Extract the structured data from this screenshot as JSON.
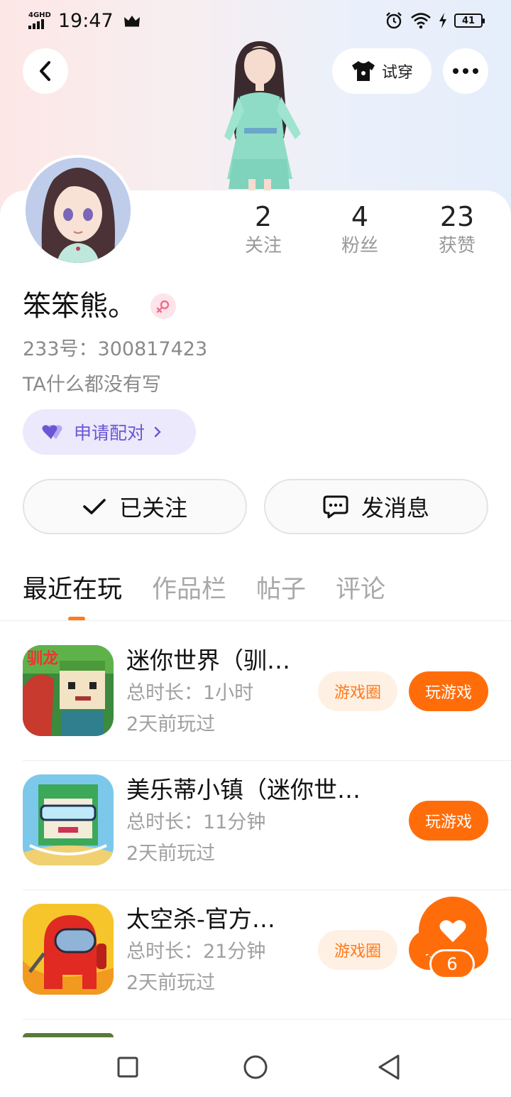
{
  "status_bar": {
    "network": "4GHD",
    "time": "19:47",
    "battery": "41"
  },
  "header": {
    "tryon_label": "试穿"
  },
  "profile": {
    "username": "笨笨熊。",
    "uid_text": "233号：300817423",
    "bio": "TA什么都没有写",
    "pair_label": "申请配对"
  },
  "stats": [
    {
      "value": "2",
      "label": "关注"
    },
    {
      "value": "4",
      "label": "粉丝"
    },
    {
      "value": "23",
      "label": "获赞"
    }
  ],
  "actions": {
    "follow_label": "已关注",
    "message_label": "发消息"
  },
  "tabs": [
    "最近在玩",
    "作品栏",
    "帖子",
    "评论"
  ],
  "games": [
    {
      "title": "迷你世界（驯…",
      "duration": "总时长：1小时",
      "last_played": "2天前玩过",
      "circle_label": "游戏圈",
      "play_label": "玩游戏"
    },
    {
      "title": "美乐蒂小镇（迷你世…",
      "duration": "总时长：11分钟",
      "last_played": "2天前玩过",
      "play_label": "玩游戏"
    },
    {
      "title": "太空杀-官方…",
      "duration": "总时长：21分钟",
      "last_played": "2天前玩过",
      "circle_label": "游戏圈",
      "play_label": "玩游戏"
    }
  ],
  "like_fab": {
    "count": "6"
  },
  "colors": {
    "accent": "#ff6d0a",
    "pair_purple": "#6b56d6",
    "muted_text": "#999999"
  }
}
